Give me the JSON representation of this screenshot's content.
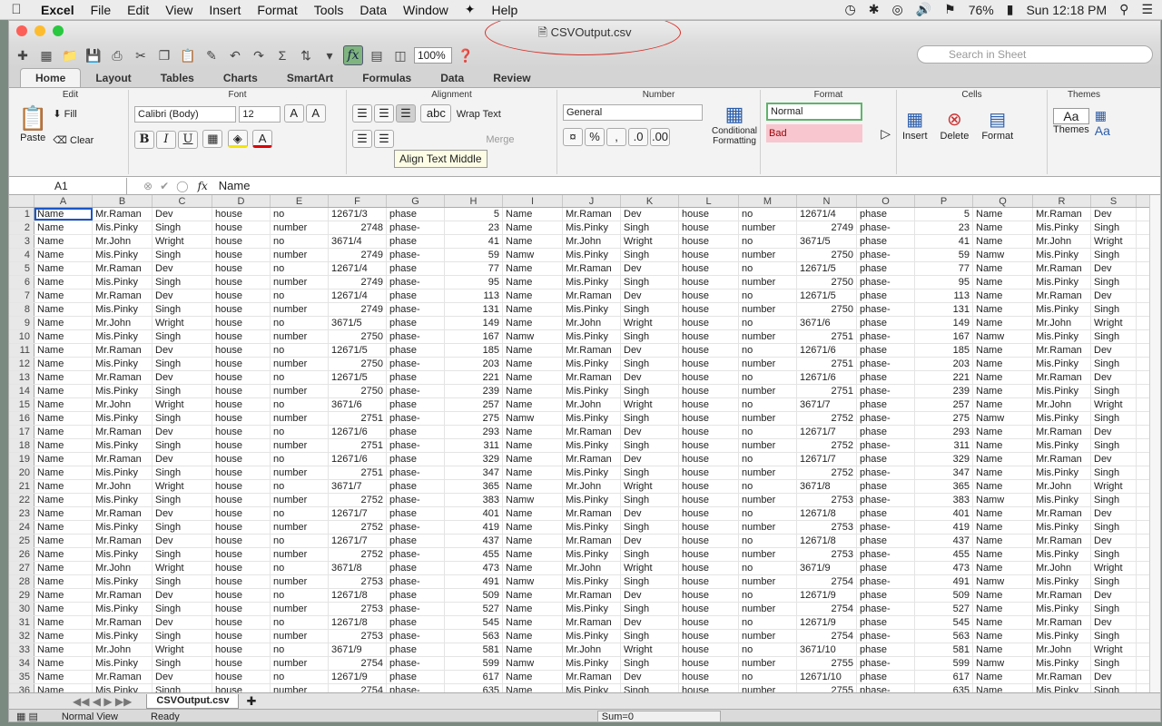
{
  "menubar": {
    "app": "Excel",
    "items": [
      "File",
      "Edit",
      "View",
      "Insert",
      "Format",
      "Tools",
      "Data",
      "Window",
      "Help"
    ],
    "battery": "76%",
    "clock": "Sun 12:18 PM"
  },
  "window": {
    "title": "CSVOutput.csv"
  },
  "toolbar": {
    "zoom": "100%",
    "search_placeholder": "Search in Sheet"
  },
  "ribbon_tabs": [
    "Home",
    "Layout",
    "Tables",
    "Charts",
    "SmartArt",
    "Formulas",
    "Data",
    "Review"
  ],
  "ribbon": {
    "edit_title": "Edit",
    "font_title": "Font",
    "alignment_title": "Alignment",
    "number_title": "Number",
    "format_title": "Format",
    "cells_title": "Cells",
    "themes_title": "Themes",
    "paste": "Paste",
    "fill": "Fill",
    "clear": "Clear",
    "font_name": "Calibri (Body)",
    "font_size": "12",
    "wrap_text": "Wrap Text",
    "merge": "Merge",
    "number_format": "General",
    "conditional_formatting": "Conditional Formatting",
    "style_normal": "Normal",
    "style_bad": "Bad",
    "insert": "Insert",
    "delete": "Delete",
    "format": "Format",
    "themes": "Themes",
    "tooltip": "Align Text Middle"
  },
  "formula_bar": {
    "cell_ref": "A1",
    "fx": "fx",
    "content": "Name"
  },
  "columns": [
    "A",
    "B",
    "C",
    "D",
    "E",
    "F",
    "G",
    "H",
    "I",
    "J",
    "K",
    "L",
    "M",
    "N",
    "O",
    "P",
    "Q",
    "R",
    "S"
  ],
  "rows": [
    [
      "Name",
      "Mr.Raman",
      "Dev",
      "house",
      "no",
      "12671/3",
      "phase",
      "5",
      "Name",
      "Mr.Raman",
      "Dev",
      "house",
      "no",
      "12671/4",
      "phase",
      "5",
      "Name",
      "Mr.Raman",
      "Dev"
    ],
    [
      "Name",
      "Mis.Pinky",
      "Singh",
      "house",
      "number",
      "2748",
      "phase-",
      "23",
      "Name",
      "Mis.Pinky",
      "Singh",
      "house",
      "number",
      "2749",
      "phase-",
      "23",
      "Name",
      "Mis.Pinky",
      "Singh"
    ],
    [
      "Name",
      "Mr.John",
      "Wright",
      "house",
      "no",
      "3671/4",
      "phase",
      "41",
      "Name",
      "Mr.John",
      "Wright",
      "house",
      "no",
      "3671/5",
      "phase",
      "41",
      "Name",
      "Mr.John",
      "Wright"
    ],
    [
      "Name",
      "Mis.Pinky",
      "Singh",
      "house",
      "number",
      "2749",
      "phase-",
      "59",
      "Namw",
      "Mis.Pinky",
      "Singh",
      "house",
      "number",
      "2750",
      "phase-",
      "59",
      "Namw",
      "Mis.Pinky",
      "Singh"
    ],
    [
      "Name",
      "Mr.Raman",
      "Dev",
      "house",
      "no",
      "12671/4",
      "phase",
      "77",
      "Name",
      "Mr.Raman",
      "Dev",
      "house",
      "no",
      "12671/5",
      "phase",
      "77",
      "Name",
      "Mr.Raman",
      "Dev"
    ],
    [
      "Name",
      "Mis.Pinky",
      "Singh",
      "house",
      "number",
      "2749",
      "phase-",
      "95",
      "Name",
      "Mis.Pinky",
      "Singh",
      "house",
      "number",
      "2750",
      "phase-",
      "95",
      "Name",
      "Mis.Pinky",
      "Singh"
    ],
    [
      "Name",
      "Mr.Raman",
      "Dev",
      "house",
      "no",
      "12671/4",
      "phase",
      "113",
      "Name",
      "Mr.Raman",
      "Dev",
      "house",
      "no",
      "12671/5",
      "phase",
      "113",
      "Name",
      "Mr.Raman",
      "Dev"
    ],
    [
      "Name",
      "Mis.Pinky",
      "Singh",
      "house",
      "number",
      "2749",
      "phase-",
      "131",
      "Name",
      "Mis.Pinky",
      "Singh",
      "house",
      "number",
      "2750",
      "phase-",
      "131",
      "Name",
      "Mis.Pinky",
      "Singh"
    ],
    [
      "Name",
      "Mr.John",
      "Wright",
      "house",
      "no",
      "3671/5",
      "phase",
      "149",
      "Name",
      "Mr.John",
      "Wright",
      "house",
      "no",
      "3671/6",
      "phase",
      "149",
      "Name",
      "Mr.John",
      "Wright"
    ],
    [
      "Name",
      "Mis.Pinky",
      "Singh",
      "house",
      "number",
      "2750",
      "phase-",
      "167",
      "Namw",
      "Mis.Pinky",
      "Singh",
      "house",
      "number",
      "2751",
      "phase-",
      "167",
      "Namw",
      "Mis.Pinky",
      "Singh"
    ],
    [
      "Name",
      "Mr.Raman",
      "Dev",
      "house",
      "no",
      "12671/5",
      "phase",
      "185",
      "Name",
      "Mr.Raman",
      "Dev",
      "house",
      "no",
      "12671/6",
      "phase",
      "185",
      "Name",
      "Mr.Raman",
      "Dev"
    ],
    [
      "Name",
      "Mis.Pinky",
      "Singh",
      "house",
      "number",
      "2750",
      "phase-",
      "203",
      "Name",
      "Mis.Pinky",
      "Singh",
      "house",
      "number",
      "2751",
      "phase-",
      "203",
      "Name",
      "Mis.Pinky",
      "Singh"
    ],
    [
      "Name",
      "Mr.Raman",
      "Dev",
      "house",
      "no",
      "12671/5",
      "phase",
      "221",
      "Name",
      "Mr.Raman",
      "Dev",
      "house",
      "no",
      "12671/6",
      "phase",
      "221",
      "Name",
      "Mr.Raman",
      "Dev"
    ],
    [
      "Name",
      "Mis.Pinky",
      "Singh",
      "house",
      "number",
      "2750",
      "phase-",
      "239",
      "Name",
      "Mis.Pinky",
      "Singh",
      "house",
      "number",
      "2751",
      "phase-",
      "239",
      "Name",
      "Mis.Pinky",
      "Singh"
    ],
    [
      "Name",
      "Mr.John",
      "Wright",
      "house",
      "no",
      "3671/6",
      "phase",
      "257",
      "Name",
      "Mr.John",
      "Wright",
      "house",
      "no",
      "3671/7",
      "phase",
      "257",
      "Name",
      "Mr.John",
      "Wright"
    ],
    [
      "Name",
      "Mis.Pinky",
      "Singh",
      "house",
      "number",
      "2751",
      "phase-",
      "275",
      "Namw",
      "Mis.Pinky",
      "Singh",
      "house",
      "number",
      "2752",
      "phase-",
      "275",
      "Namw",
      "Mis.Pinky",
      "Singh"
    ],
    [
      "Name",
      "Mr.Raman",
      "Dev",
      "house",
      "no",
      "12671/6",
      "phase",
      "293",
      "Name",
      "Mr.Raman",
      "Dev",
      "house",
      "no",
      "12671/7",
      "phase",
      "293",
      "Name",
      "Mr.Raman",
      "Dev"
    ],
    [
      "Name",
      "Mis.Pinky",
      "Singh",
      "house",
      "number",
      "2751",
      "phase-",
      "311",
      "Name",
      "Mis.Pinky",
      "Singh",
      "house",
      "number",
      "2752",
      "phase-",
      "311",
      "Name",
      "Mis.Pinky",
      "Singh"
    ],
    [
      "Name",
      "Mr.Raman",
      "Dev",
      "house",
      "no",
      "12671/6",
      "phase",
      "329",
      "Name",
      "Mr.Raman",
      "Dev",
      "house",
      "no",
      "12671/7",
      "phase",
      "329",
      "Name",
      "Mr.Raman",
      "Dev"
    ],
    [
      "Name",
      "Mis.Pinky",
      "Singh",
      "house",
      "number",
      "2751",
      "phase-",
      "347",
      "Name",
      "Mis.Pinky",
      "Singh",
      "house",
      "number",
      "2752",
      "phase-",
      "347",
      "Name",
      "Mis.Pinky",
      "Singh"
    ],
    [
      "Name",
      "Mr.John",
      "Wright",
      "house",
      "no",
      "3671/7",
      "phase",
      "365",
      "Name",
      "Mr.John",
      "Wright",
      "house",
      "no",
      "3671/8",
      "phase",
      "365",
      "Name",
      "Mr.John",
      "Wright"
    ],
    [
      "Name",
      "Mis.Pinky",
      "Singh",
      "house",
      "number",
      "2752",
      "phase-",
      "383",
      "Namw",
      "Mis.Pinky",
      "Singh",
      "house",
      "number",
      "2753",
      "phase-",
      "383",
      "Namw",
      "Mis.Pinky",
      "Singh"
    ],
    [
      "Name",
      "Mr.Raman",
      "Dev",
      "house",
      "no",
      "12671/7",
      "phase",
      "401",
      "Name",
      "Mr.Raman",
      "Dev",
      "house",
      "no",
      "12671/8",
      "phase",
      "401",
      "Name",
      "Mr.Raman",
      "Dev"
    ],
    [
      "Name",
      "Mis.Pinky",
      "Singh",
      "house",
      "number",
      "2752",
      "phase-",
      "419",
      "Name",
      "Mis.Pinky",
      "Singh",
      "house",
      "number",
      "2753",
      "phase-",
      "419",
      "Name",
      "Mis.Pinky",
      "Singh"
    ],
    [
      "Name",
      "Mr.Raman",
      "Dev",
      "house",
      "no",
      "12671/7",
      "phase",
      "437",
      "Name",
      "Mr.Raman",
      "Dev",
      "house",
      "no",
      "12671/8",
      "phase",
      "437",
      "Name",
      "Mr.Raman",
      "Dev"
    ],
    [
      "Name",
      "Mis.Pinky",
      "Singh",
      "house",
      "number",
      "2752",
      "phase-",
      "455",
      "Name",
      "Mis.Pinky",
      "Singh",
      "house",
      "number",
      "2753",
      "phase-",
      "455",
      "Name",
      "Mis.Pinky",
      "Singh"
    ],
    [
      "Name",
      "Mr.John",
      "Wright",
      "house",
      "no",
      "3671/8",
      "phase",
      "473",
      "Name",
      "Mr.John",
      "Wright",
      "house",
      "no",
      "3671/9",
      "phase",
      "473",
      "Name",
      "Mr.John",
      "Wright"
    ],
    [
      "Name",
      "Mis.Pinky",
      "Singh",
      "house",
      "number",
      "2753",
      "phase-",
      "491",
      "Namw",
      "Mis.Pinky",
      "Singh",
      "house",
      "number",
      "2754",
      "phase-",
      "491",
      "Namw",
      "Mis.Pinky",
      "Singh"
    ],
    [
      "Name",
      "Mr.Raman",
      "Dev",
      "house",
      "no",
      "12671/8",
      "phase",
      "509",
      "Name",
      "Mr.Raman",
      "Dev",
      "house",
      "no",
      "12671/9",
      "phase",
      "509",
      "Name",
      "Mr.Raman",
      "Dev"
    ],
    [
      "Name",
      "Mis.Pinky",
      "Singh",
      "house",
      "number",
      "2753",
      "phase-",
      "527",
      "Name",
      "Mis.Pinky",
      "Singh",
      "house",
      "number",
      "2754",
      "phase-",
      "527",
      "Name",
      "Mis.Pinky",
      "Singh"
    ],
    [
      "Name",
      "Mr.Raman",
      "Dev",
      "house",
      "no",
      "12671/8",
      "phase",
      "545",
      "Name",
      "Mr.Raman",
      "Dev",
      "house",
      "no",
      "12671/9",
      "phase",
      "545",
      "Name",
      "Mr.Raman",
      "Dev"
    ],
    [
      "Name",
      "Mis.Pinky",
      "Singh",
      "house",
      "number",
      "2753",
      "phase-",
      "563",
      "Name",
      "Mis.Pinky",
      "Singh",
      "house",
      "number",
      "2754",
      "phase-",
      "563",
      "Name",
      "Mis.Pinky",
      "Singh"
    ],
    [
      "Name",
      "Mr.John",
      "Wright",
      "house",
      "no",
      "3671/9",
      "phase",
      "581",
      "Name",
      "Mr.John",
      "Wright",
      "house",
      "no",
      "3671/10",
      "phase",
      "581",
      "Name",
      "Mr.John",
      "Wright"
    ],
    [
      "Name",
      "Mis.Pinky",
      "Singh",
      "house",
      "number",
      "2754",
      "phase-",
      "599",
      "Namw",
      "Mis.Pinky",
      "Singh",
      "house",
      "number",
      "2755",
      "phase-",
      "599",
      "Namw",
      "Mis.Pinky",
      "Singh"
    ],
    [
      "Name",
      "Mr.Raman",
      "Dev",
      "house",
      "no",
      "12671/9",
      "phase",
      "617",
      "Name",
      "Mr.Raman",
      "Dev",
      "house",
      "no",
      "12671/10",
      "phase",
      "617",
      "Name",
      "Mr.Raman",
      "Dev"
    ],
    [
      "Name",
      "Mis.Pinky",
      "Singh",
      "house",
      "number",
      "2754",
      "phase-",
      "635",
      "Name",
      "Mis.Pinky",
      "Singh",
      "house",
      "number",
      "2755",
      "phase-",
      "635",
      "Name",
      "Mis.Pinky",
      "Singh"
    ]
  ],
  "sheet_tab": "CSVOutput.csv",
  "status": {
    "view": "Normal View",
    "state": "Ready",
    "sum": "Sum=0"
  },
  "colors": {
    "selection": "#1a56c6",
    "bad_fill": "#f8c6ce",
    "normal_border": "#5fb36b",
    "annotation": "#d8322b"
  }
}
